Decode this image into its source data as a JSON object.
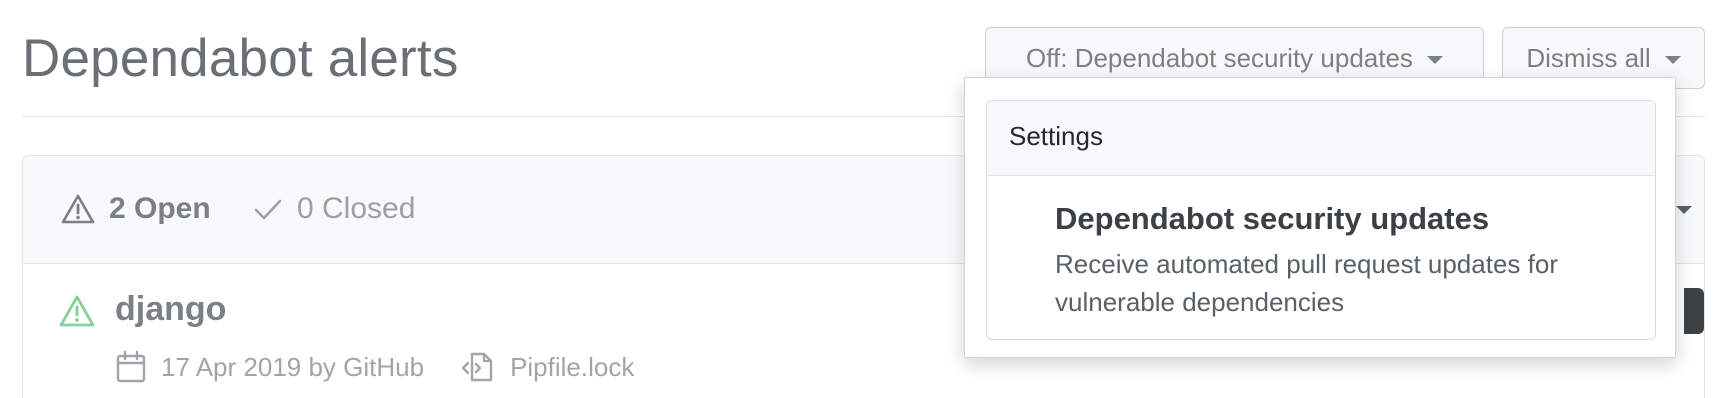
{
  "page": {
    "title": "Dependabot alerts"
  },
  "toolbar": {
    "security_updates_label": "Off: Dependabot security updates",
    "dismiss_all_label": "Dismiss all"
  },
  "filters": {
    "open_label": "2 Open",
    "closed_label": "0 Closed"
  },
  "alerts": [
    {
      "name": "django",
      "date_author": "17 Apr 2019 by GitHub",
      "manifest": "Pipfile.lock"
    }
  ],
  "dropdown": {
    "heading": "Settings",
    "item_title": "Dependabot security updates",
    "item_description": "Receive automated pull request updates for vulnerable dependencies"
  },
  "colors": {
    "alert_icon": "#85d19b",
    "muted_text": "#7b8088"
  },
  "icons": {
    "open": "alert-icon",
    "closed": "check-icon",
    "date": "calendar-icon",
    "manifest": "file-code-icon"
  }
}
